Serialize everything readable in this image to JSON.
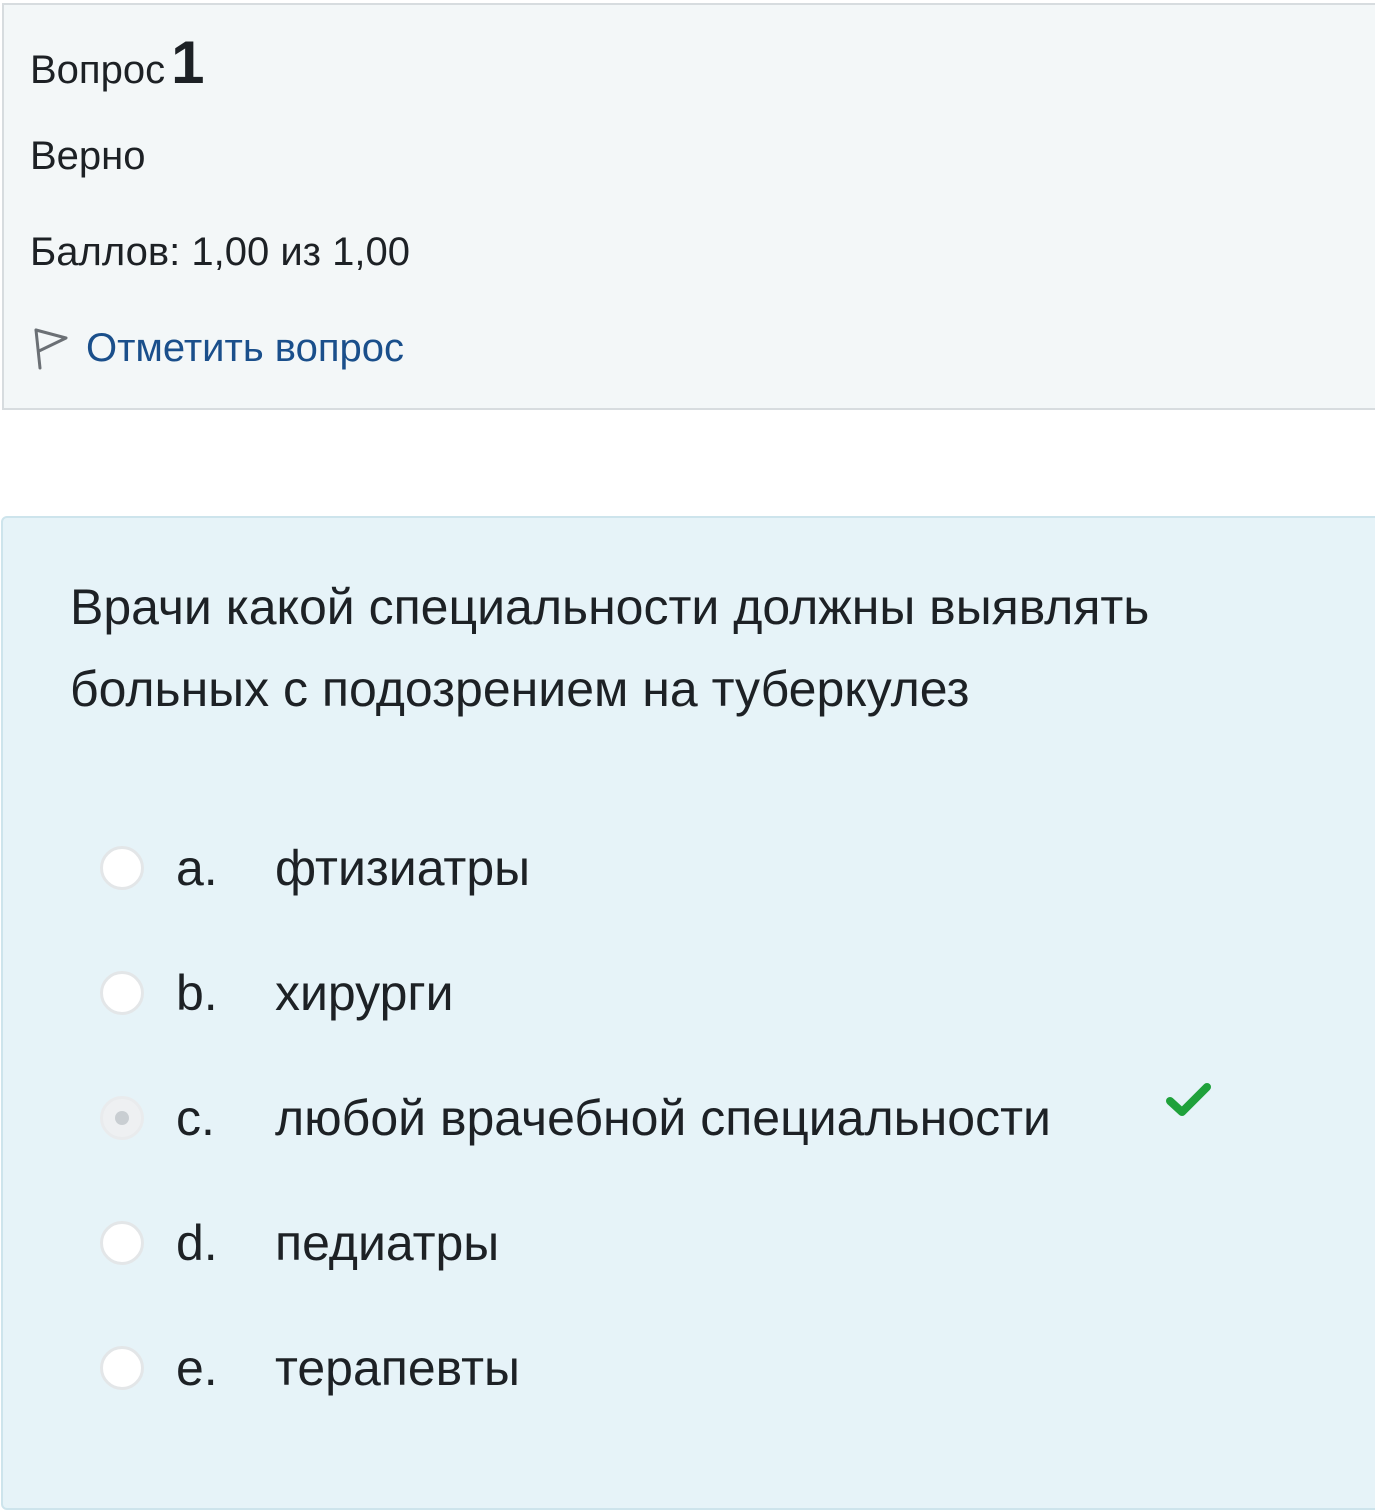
{
  "info": {
    "question_word": "Вопрос",
    "question_number": "1",
    "state": "Верно",
    "grade": "Баллов: 1,00 из 1,00",
    "flag_label": "Отметить вопрос",
    "flag_icon": "flag-icon"
  },
  "question": {
    "text": "Врачи какой специальности должны выявлять больных с подозрением на туберкулез",
    "answers": [
      {
        "letter": "a.",
        "text": "фтизиатры",
        "checked": false
      },
      {
        "letter": "b.",
        "text": "хирурги",
        "checked": false
      },
      {
        "letter": "c.",
        "text": "любой врачебной специальности",
        "checked": true,
        "correct": true
      },
      {
        "letter": "d.",
        "text": "педиатры",
        "checked": false
      },
      {
        "letter": "e.",
        "text": "терапевты",
        "checked": false
      }
    ],
    "correct_icon": "check-icon",
    "correct_color": "#1fa13b"
  }
}
